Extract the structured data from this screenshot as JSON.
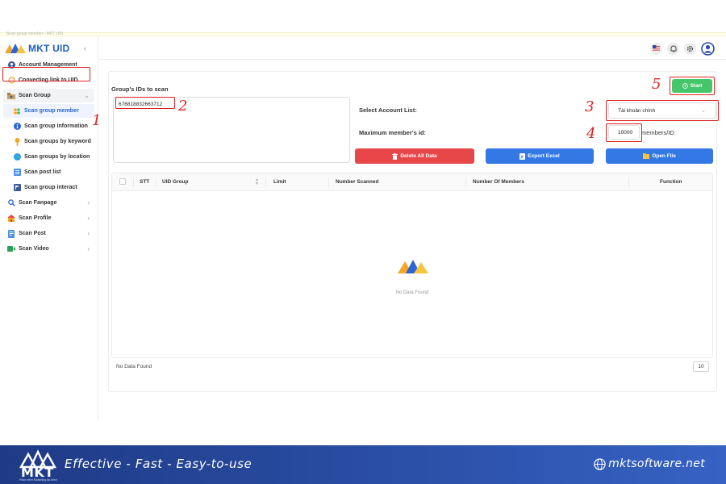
{
  "window": {
    "title": "Scan group member - MKT UID"
  },
  "app": {
    "name": "MKT UID"
  },
  "sidebar": {
    "items": [
      {
        "label": "Account Management"
      },
      {
        "label": "Converting link to UID"
      },
      {
        "label": "Scan Group"
      },
      {
        "label": "Scan group member"
      },
      {
        "label": "Scan group information"
      },
      {
        "label": "Scan groups by keyword"
      },
      {
        "label": "Scan groups by location"
      },
      {
        "label": "Scan post list"
      },
      {
        "label": "Scan group interact"
      },
      {
        "label": "Scan Fanpage"
      },
      {
        "label": "Scan Profile"
      },
      {
        "label": "Scan Post"
      },
      {
        "label": "Scan Video"
      }
    ],
    "active_index": 3
  },
  "main": {
    "ids_label": "Group's IDs to scan",
    "ids_value": "676818832663712",
    "account_list_label": "Select Account List:",
    "account_list_value": "Tài khoản chính",
    "max_member_label": "Maximum member's id:",
    "max_member_value": "10000",
    "max_member_unit": "members/ID",
    "start_label": "Start",
    "delete_label": "Delete All Data",
    "export_label": "Export Excel",
    "open_label": "Open File"
  },
  "table": {
    "columns": [
      "STT",
      "UID Group",
      "Limit",
      "Number Scanned",
      "Number Of Members",
      "Function"
    ],
    "rows": [],
    "empty_text": "No Data Found",
    "footer_text": "No Data Found",
    "page_size": "10"
  },
  "annotations": {
    "n1": "1",
    "n2": "2",
    "n3": "3",
    "n4": "4",
    "n5": "5"
  },
  "banner": {
    "logo_text": "MKT",
    "logo_sub": "Phần mềm Marketing đa kênh",
    "slogan": "Effective - Fast - Easy-to-use",
    "site": "mktsoftware.net"
  },
  "colors": {
    "accent": "#2a66d6",
    "red": "#e8474a",
    "blue": "#3478e6",
    "green": "#46c66a",
    "annotation": "#e02020",
    "banner": "#2a4fa6"
  }
}
